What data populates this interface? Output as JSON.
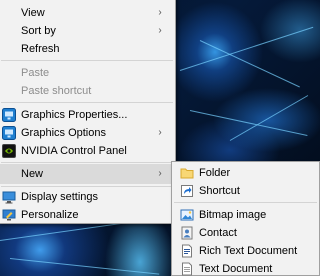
{
  "context_menu": {
    "items": {
      "view": "View",
      "sort_by": "Sort by",
      "refresh": "Refresh",
      "paste": "Paste",
      "paste_shortcut": "Paste shortcut",
      "graphics_properties": "Graphics Properties...",
      "graphics_options": "Graphics Options",
      "nvidia_control_panel": "NVIDIA Control Panel",
      "new": "New",
      "display_settings": "Display settings",
      "personalize": "Personalize"
    },
    "submenu_arrow": "›"
  },
  "new_submenu": {
    "items": {
      "folder": "Folder",
      "shortcut": "Shortcut",
      "bitmap_image": "Bitmap image",
      "contact": "Contact",
      "rich_text_document": "Rich Text Document",
      "text_document": "Text Document"
    }
  },
  "colors": {
    "menu_background": "#f2f2f2",
    "highlight": "#dadada",
    "disabled_text": "#8d8d8d"
  }
}
